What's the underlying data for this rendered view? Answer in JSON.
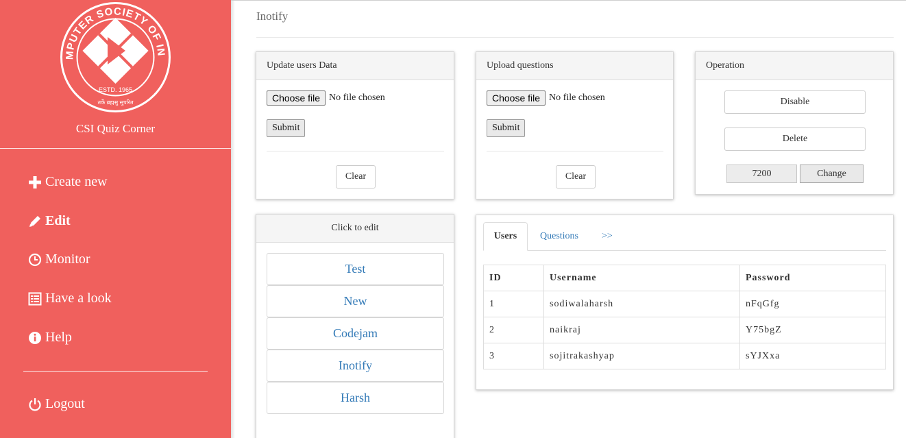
{
  "sidebar": {
    "logo": {
      "ring_text": "COMPUTER SOCIETY OF INDIA",
      "estd": "ESTD. 1965",
      "motto": "तर्के ब्रह्मसु सुपरित"
    },
    "brand": "CSI Quiz Corner",
    "nav": [
      {
        "label": "Create new",
        "icon": "plus-icon",
        "active": false
      },
      {
        "label": "Edit",
        "icon": "pencil-icon",
        "active": true
      },
      {
        "label": "Monitor",
        "icon": "clock-icon",
        "active": false
      },
      {
        "label": "Have a look",
        "icon": "list-icon",
        "active": false
      },
      {
        "label": "Help",
        "icon": "info-icon",
        "active": false
      }
    ],
    "logout": {
      "label": "Logout",
      "icon": "power-icon"
    },
    "colors": {
      "background": "#f0605d",
      "text": "#ffffff"
    }
  },
  "header": {
    "title": "Inotify"
  },
  "update_users": {
    "title": "Update users Data",
    "choose_file": "Choose file",
    "file_status": "No file chosen",
    "submit": "Submit",
    "clear": "Clear"
  },
  "upload_questions": {
    "title": "Upload questions",
    "choose_file": "Choose file",
    "file_status": "No file chosen",
    "submit": "Submit",
    "clear": "Clear"
  },
  "operation": {
    "title": "Operation",
    "disable": "Disable",
    "delete": "Delete",
    "value": "7200",
    "change": "Change"
  },
  "click_to_edit": {
    "title": "Click to edit",
    "items": [
      "Test",
      "New",
      "Codejam",
      "Inotify",
      "Harsh"
    ],
    "link_color": "#337ab7"
  },
  "tabs": {
    "items": [
      "Users",
      "Questions",
      ">>"
    ],
    "active": "Users"
  },
  "users_table": {
    "headers": [
      "ID",
      "Username",
      "Password"
    ],
    "rows": [
      [
        "1",
        "sodiwalaharsh",
        "nFqGfg"
      ],
      [
        "2",
        "naikraj",
        "Y75bgZ"
      ],
      [
        "3",
        "sojitrakashyap",
        "sYJXxa"
      ]
    ]
  }
}
